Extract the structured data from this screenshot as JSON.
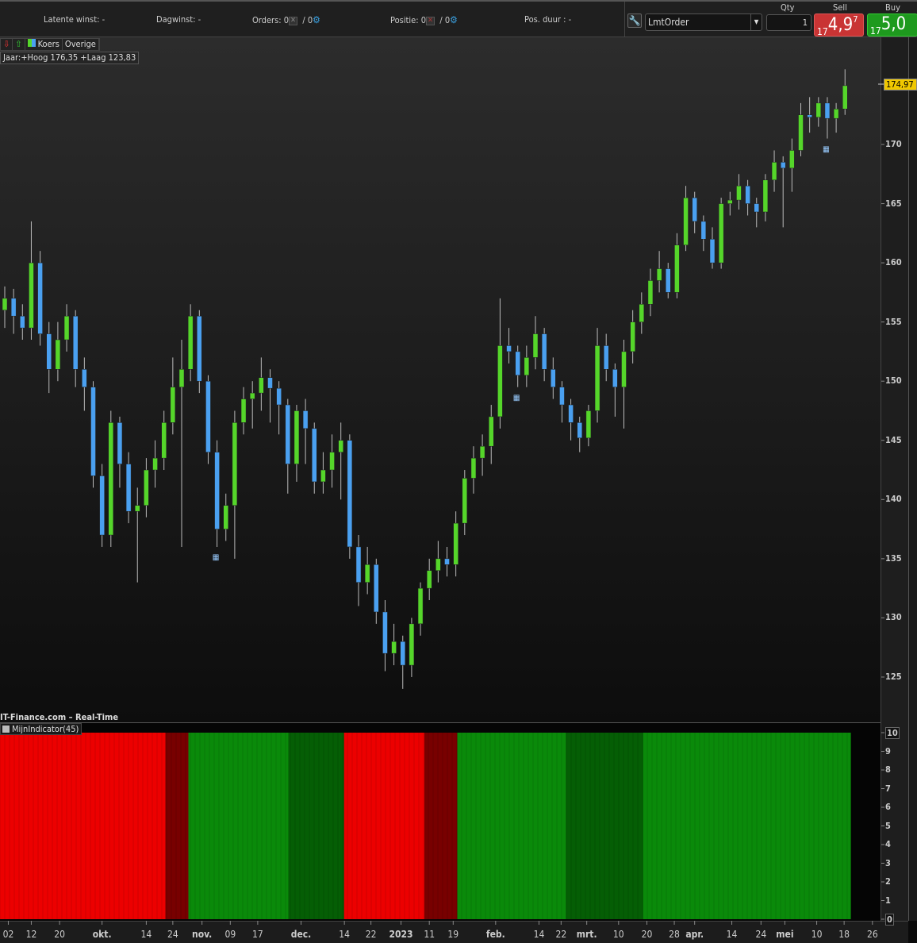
{
  "topbar": {
    "latent_label": "Latente winst:",
    "latent_value": "-",
    "day_label": "Dagwinst:",
    "day_value": "-",
    "orders_label": "Orders:",
    "orders_open": "0",
    "orders_sep": "/",
    "orders_exec": "0",
    "position_label": "Positie:",
    "position_open": "0",
    "position_sep": "/",
    "position_exec": "0",
    "duration_label": "Pos. duur :",
    "duration_value": "-"
  },
  "order_panel": {
    "order_type": "LmtOrder",
    "qty_label": "Qty",
    "qty": "1",
    "sell_label": "Sell",
    "sell_prefix": "17",
    "sell_big": "4,9",
    "sell_sup": "7",
    "buy_label": "Buy",
    "buy_prefix": "17",
    "buy_big": "5,0"
  },
  "chart_legend": {
    "koers": "Koers",
    "overige": "Overige"
  },
  "year_range": "Jaar:+Hoog 176,35 +Laag 123,83",
  "watermark": "IT-Finance.com – Real-Time",
  "last_price": "174,97",
  "colors": {
    "up": "#55d62a",
    "down": "#4aa0f0",
    "bear": "#ec0000",
    "bear_weak": "#780000",
    "bull": "#0a8a0a",
    "bull_weak": "#055e05"
  },
  "chart_data": {
    "type": "candlestick",
    "ylim": [
      122,
      178
    ],
    "yticks": [
      "125",
      "130",
      "135",
      "140",
      "145",
      "150",
      "155",
      "160",
      "165",
      "170"
    ],
    "candles": [
      [
        156,
        158,
        154.5,
        157
      ],
      [
        157,
        157.8,
        154,
        155.5
      ],
      [
        155.5,
        156.5,
        153.5,
        154.5
      ],
      [
        154.5,
        163.5,
        153.5,
        160
      ],
      [
        160,
        161,
        153,
        154
      ],
      [
        154,
        155,
        149,
        151
      ],
      [
        151,
        155,
        150,
        153.5
      ],
      [
        153.5,
        156.5,
        152.5,
        155.5
      ],
      [
        155.5,
        156,
        149.5,
        151
      ],
      [
        151,
        152,
        147.5,
        149.5
      ],
      [
        149.5,
        150,
        141,
        142
      ],
      [
        142,
        143,
        136,
        137
      ],
      [
        137,
        147.5,
        136,
        146.5
      ],
      [
        146.5,
        147,
        141,
        143
      ],
      [
        143,
        144,
        138,
        139
      ],
      [
        139,
        141,
        133,
        139.5
      ],
      [
        139.5,
        143.5,
        138.5,
        142.5
      ],
      [
        142.5,
        145,
        141,
        143.5
      ],
      [
        143.5,
        147.5,
        142.5,
        146.5
      ],
      [
        146.5,
        152,
        145.5,
        149.5
      ],
      [
        149.5,
        153.5,
        136,
        151
      ],
      [
        151,
        156.5,
        150,
        155.5
      ],
      [
        155.5,
        156,
        149,
        150
      ],
      [
        150,
        150.5,
        143,
        144
      ],
      [
        144,
        145,
        136,
        137.5
      ],
      [
        137.5,
        140.5,
        136.5,
        139.5
      ],
      [
        139.5,
        147.5,
        135,
        146.5
      ],
      [
        146.5,
        149.5,
        145.5,
        148.5
      ],
      [
        148.5,
        150,
        146,
        149
      ],
      [
        149,
        152,
        147.5,
        150.3
      ],
      [
        150.3,
        151,
        146.5,
        149.4
      ],
      [
        149.4,
        150,
        145.5,
        148
      ],
      [
        148,
        148.5,
        140.5,
        143
      ],
      [
        143,
        148,
        141.5,
        147.5
      ],
      [
        147.5,
        148.5,
        143,
        146
      ],
      [
        146,
        146.5,
        140.5,
        141.5
      ],
      [
        141.5,
        144,
        140.5,
        142.5
      ],
      [
        142.5,
        145.5,
        141,
        144
      ],
      [
        144,
        146.5,
        140,
        145
      ],
      [
        145,
        145.5,
        135,
        136
      ],
      [
        136,
        137,
        131,
        133
      ],
      [
        133,
        136,
        132,
        134.5
      ],
      [
        134.5,
        135,
        129.5,
        130.5
      ],
      [
        130.5,
        131.5,
        125.5,
        127
      ],
      [
        127,
        129.5,
        126,
        128
      ],
      [
        128,
        128.5,
        124,
        126
      ],
      [
        126,
        130,
        125,
        129.5
      ],
      [
        129.5,
        133,
        128.5,
        132.5
      ],
      [
        132.5,
        135,
        131.5,
        134
      ],
      [
        134,
        136.5,
        133,
        135
      ],
      [
        135,
        136,
        133.5,
        134.5
      ],
      [
        134.5,
        139,
        133.5,
        138
      ],
      [
        138,
        142.5,
        137,
        141.8
      ],
      [
        141.8,
        144.5,
        140.5,
        143.5
      ],
      [
        143.5,
        145.5,
        142,
        144.5
      ],
      [
        144.5,
        148,
        143,
        147
      ],
      [
        147,
        157,
        146,
        153
      ],
      [
        153,
        154.5,
        151.5,
        152.5
      ],
      [
        152.5,
        153,
        149.5,
        150.5
      ],
      [
        150.5,
        153,
        149.5,
        152
      ],
      [
        152,
        155.5,
        151,
        154
      ],
      [
        154,
        154.5,
        150,
        151
      ],
      [
        151,
        152,
        148.5,
        149.5
      ],
      [
        149.5,
        150,
        146.5,
        148
      ],
      [
        148,
        148.5,
        145,
        146.5
      ],
      [
        146.5,
        147,
        144,
        145.2
      ],
      [
        145.2,
        148,
        144.5,
        147.5
      ],
      [
        147.5,
        154.5,
        146.5,
        153
      ],
      [
        153,
        154,
        150,
        151
      ],
      [
        151,
        151.5,
        147,
        149.5
      ],
      [
        149.5,
        153.5,
        146,
        152.5
      ],
      [
        152.5,
        156,
        151.5,
        155
      ],
      [
        155,
        157.5,
        154,
        156.5
      ],
      [
        156.5,
        159.5,
        155.5,
        158.5
      ],
      [
        158.5,
        161,
        157.5,
        159.5
      ],
      [
        159.5,
        160,
        157,
        157.5
      ],
      [
        157.5,
        162.5,
        157,
        161.5
      ],
      [
        161.5,
        166.5,
        161,
        165.5
      ],
      [
        165.5,
        166,
        162.5,
        163.5
      ],
      [
        163.5,
        164,
        161,
        162
      ],
      [
        162,
        163,
        159.5,
        160
      ],
      [
        160,
        165.5,
        159.5,
        165
      ],
      [
        165,
        166,
        164,
        165.3
      ],
      [
        165.3,
        167.5,
        164.5,
        166.5
      ],
      [
        166.5,
        167,
        164,
        165
      ],
      [
        165,
        165.5,
        163,
        164.3
      ],
      [
        164.3,
        167.5,
        163.5,
        167
      ],
      [
        167,
        169.5,
        166,
        168.5
      ],
      [
        168.5,
        169,
        163,
        168
      ],
      [
        168,
        170.5,
        166,
        169.5
      ],
      [
        169.5,
        173.5,
        169,
        172.5
      ],
      [
        172.5,
        174,
        171,
        172.3
      ],
      [
        172.3,
        174,
        171.5,
        173.5
      ],
      [
        173.5,
        174,
        170.5,
        172.2
      ],
      [
        172.2,
        173.5,
        171,
        173
      ],
      [
        173,
        176.35,
        172.5,
        174.97
      ]
    ],
    "event_markers": [
      24,
      58,
      93
    ],
    "xticks": [
      {
        "label": "02",
        "at": 0.4
      },
      {
        "label": "12",
        "at": 3
      },
      {
        "label": "20",
        "at": 6.2
      },
      {
        "label": "okt.",
        "at": 11,
        "major": true
      },
      {
        "label": "14",
        "at": 16
      },
      {
        "label": "24",
        "at": 19
      },
      {
        "label": "nov.",
        "at": 22.3,
        "major": true
      },
      {
        "label": "09",
        "at": 25.5
      },
      {
        "label": "17",
        "at": 28.6
      },
      {
        "label": "dec.",
        "at": 33.5,
        "major": true
      },
      {
        "label": "14",
        "at": 38.4
      },
      {
        "label": "22",
        "at": 41.4
      },
      {
        "label": "2023",
        "at": 44.8,
        "major": true
      },
      {
        "label": "11",
        "at": 48
      },
      {
        "label": "19",
        "at": 50.7
      },
      {
        "label": "feb.",
        "at": 55.5,
        "major": true
      },
      {
        "label": "14",
        "at": 60.4
      },
      {
        "label": "22",
        "at": 62.9
      },
      {
        "label": "mrt.",
        "at": 65.8,
        "major": true
      },
      {
        "label": "10",
        "at": 69.4
      },
      {
        "label": "20",
        "at": 72.6
      },
      {
        "label": "28",
        "at": 75.7
      },
      {
        "label": "apr.",
        "at": 78,
        "major": true
      },
      {
        "label": "14",
        "at": 82.2
      },
      {
        "label": "24",
        "at": 85.5
      },
      {
        "label": "mei",
        "at": 88.2,
        "major": true
      },
      {
        "label": "10",
        "at": 91.8
      },
      {
        "label": "18",
        "at": 94.9
      },
      {
        "label": "26",
        "at": 98.1
      }
    ]
  },
  "indicator": {
    "name": "MijnIndicator(45)",
    "ylim": [
      0,
      10
    ],
    "yticks": [
      "0",
      "1",
      "2",
      "3",
      "4",
      "5",
      "6",
      "7",
      "8",
      "9",
      "10"
    ],
    "segments": [
      {
        "from": 0,
        "to": 18.7,
        "state": "bear"
      },
      {
        "from": 18.7,
        "to": 21.3,
        "state": "bear_weak"
      },
      {
        "from": 21.3,
        "to": 32.6,
        "state": "bull"
      },
      {
        "from": 32.6,
        "to": 38.9,
        "state": "bull_weak"
      },
      {
        "from": 38.9,
        "to": 48,
        "state": "bear"
      },
      {
        "from": 48,
        "to": 51.7,
        "state": "bear_weak"
      },
      {
        "from": 51.7,
        "to": 64,
        "state": "bull"
      },
      {
        "from": 64,
        "to": 72.7,
        "state": "bull_weak"
      },
      {
        "from": 72.7,
        "to": 96.2,
        "state": "bull"
      }
    ]
  }
}
